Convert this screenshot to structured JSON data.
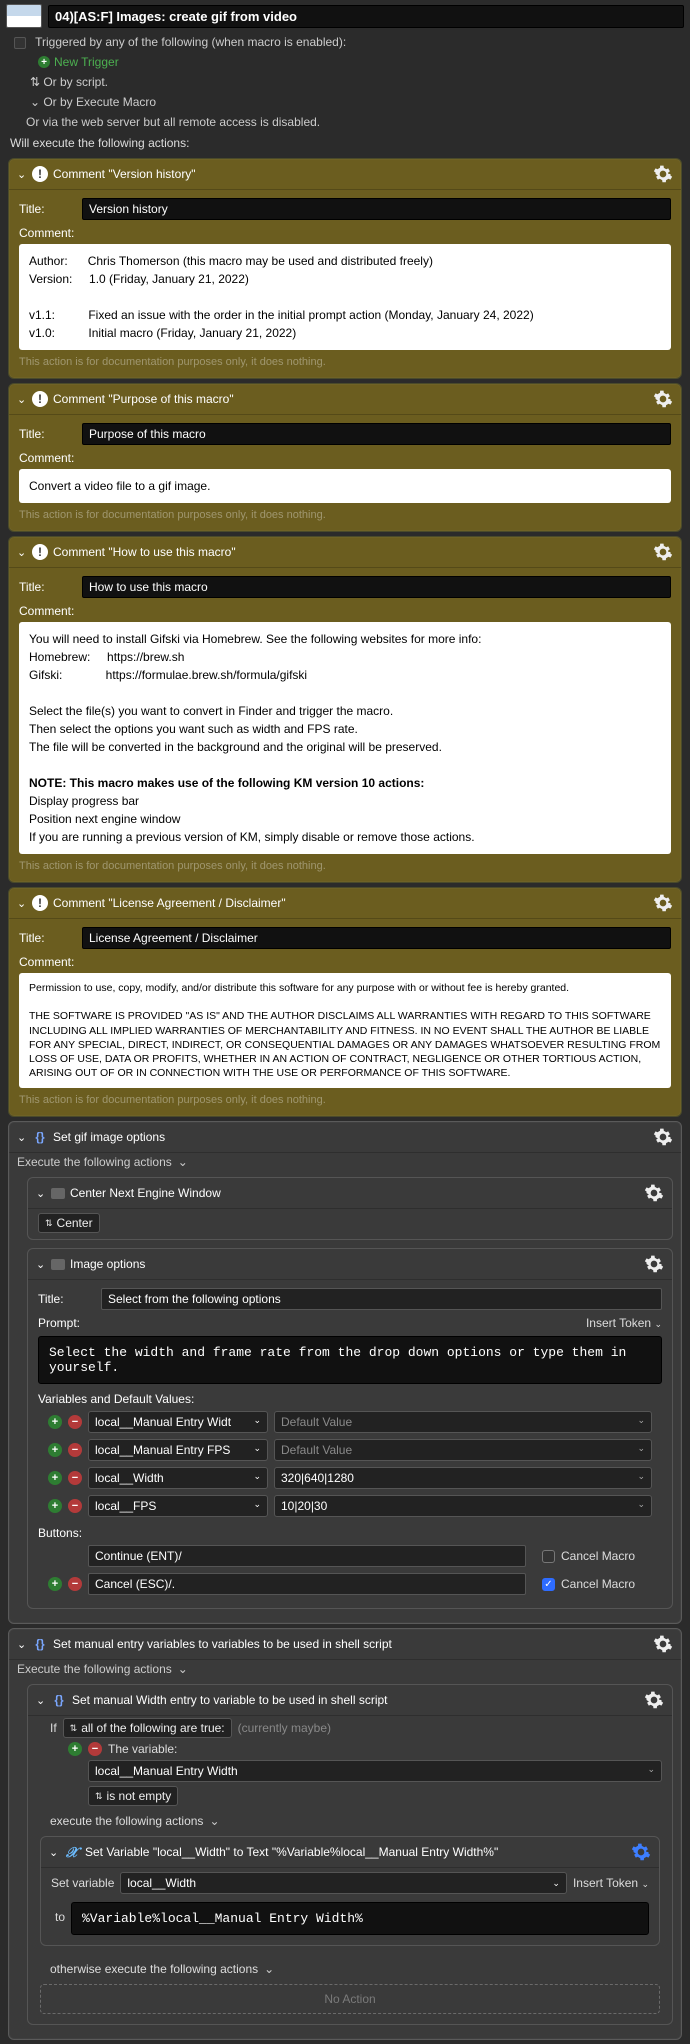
{
  "macro": {
    "title": "04)[AS:F] Images: create gif from video",
    "trigger_header": "Triggered by any of the following (when macro is enabled):",
    "new_trigger": "New Trigger",
    "or_script": "Or by script.",
    "or_execute": "Or by Execute Macro",
    "or_web": "Or via the web server but all remote access is disabled.",
    "will_execute": "Will execute the following actions:"
  },
  "comments": [
    {
      "head": "Comment \"Version history\"",
      "title_label": "Title:",
      "title_value": "Version history",
      "comment_label": "Comment:",
      "body_html": "Author:&nbsp;&nbsp;&nbsp;&nbsp;&nbsp;&nbsp;Chris Thomerson (this macro may be used and distributed freely)<br>Version:&nbsp;&nbsp;&nbsp;&nbsp;&nbsp;1.0 (Friday, January 21, 2022)<br><br>v1.1:&nbsp;&nbsp;&nbsp;&nbsp;&nbsp;&nbsp;&nbsp;&nbsp;&nbsp;&nbsp;Fixed an issue with the order in the initial prompt action (Monday, January 24, 2022)<br>v1.0:&nbsp;&nbsp;&nbsp;&nbsp;&nbsp;&nbsp;&nbsp;&nbsp;&nbsp;&nbsp;Initial macro (Friday, January 21, 2022)",
      "footer": "This action is for documentation purposes only, it does nothing."
    },
    {
      "head": "Comment \"Purpose of this macro\"",
      "title_value": "Purpose of this macro",
      "body_html": "Convert a video file to a gif image.",
      "footer": "This action is for documentation purposes only, it does nothing."
    },
    {
      "head": "Comment \"How to use this macro\"",
      "title_value": "How to use this macro",
      "body_html": "You will need to install Gifski via Homebrew. See the following websites for more info:<br>Homebrew:&nbsp;&nbsp;&nbsp;&nbsp;&nbsp;https://brew.sh<br>Gifski:&nbsp;&nbsp;&nbsp;&nbsp;&nbsp;&nbsp;&nbsp;&nbsp;&nbsp;&nbsp;&nbsp;&nbsp;&nbsp;https://formulae.brew.sh/formula/gifski<br><br>Select the file(s) you want to convert in Finder and trigger the macro.<br>Then select the options you want such as width and FPS rate.<br>The file will be converted in the background and the original will be preserved.<br><br><b>NOTE: This macro makes use of the following KM version 10 actions:</b><br>Display progress bar<br>Position next engine window<br>If you are running a previous version of KM, simply disable or remove those actions.",
      "footer": "This action is for documentation purposes only, it does nothing."
    },
    {
      "head": "Comment \"License Agreement / Disclaimer\"",
      "title_value": "License Agreement / Disclaimer",
      "body_html_small": "Permission to use, copy, modify, and/or distribute this software for any purpose with or without fee is hereby granted.<br><br>THE SOFTWARE IS PROVIDED \"AS IS\" AND THE AUTHOR DISCLAIMS ALL WARRANTIES WITH REGARD TO THIS SOFTWARE INCLUDING ALL IMPLIED WARRANTIES OF MERCHANTABILITY AND FITNESS. IN NO EVENT SHALL THE AUTHOR BE LIABLE FOR ANY SPECIAL, DIRECT, INDIRECT, OR CONSEQUENTIAL DAMAGES OR ANY DAMAGES WHATSOEVER RESULTING FROM LOSS OF USE, DATA OR PROFITS, WHETHER IN AN ACTION OF CONTRACT, NEGLIGENCE OR OTHER TORTIOUS ACTION, ARISING OUT OF OR IN CONNECTION WITH THE USE OR PERFORMANCE OF THIS SOFTWARE.",
      "footer": "This action is for documentation purposes only, it does nothing."
    }
  ],
  "labels": {
    "title": "Title:",
    "comment": "Comment:",
    "execute_following": "Execute the following actions",
    "center": "Center",
    "prompt": "Prompt:",
    "insert_token": "Insert Token",
    "vars_defaults": "Variables and Default Values:",
    "default_value": "Default Value",
    "buttons": "Buttons:",
    "cancel_macro": "Cancel Macro",
    "if": "If",
    "all_true": "all of the following are true:",
    "currently": "(currently maybe)",
    "the_variable": "The variable:",
    "is_not_empty": "is not empty",
    "execute_following2": "execute the following actions",
    "set_variable": "Set variable",
    "to": "to",
    "otherwise": "otherwise execute the following actions",
    "no_action": "No Action"
  },
  "group1": {
    "head": "Set gif image options",
    "child1_head": "Center Next Engine Window",
    "child2_head": "Image options",
    "child2_title": "Select from the following options",
    "prompt_text": "Select the width and frame rate from the drop down options or type them in yourself.",
    "vars": [
      {
        "name": "local__Manual Entry Widt",
        "value": "",
        "placeholder": true
      },
      {
        "name": "local__Manual Entry FPS",
        "value": "",
        "placeholder": true
      },
      {
        "name": "local__Width",
        "value": "320|640|1280",
        "placeholder": false
      },
      {
        "name": "local__FPS",
        "value": "10|20|30",
        "placeholder": false
      }
    ],
    "buttons": [
      {
        "label": "Continue (ENT)/",
        "cancel": false
      },
      {
        "label": "Cancel (ESC)/.",
        "cancel": true
      }
    ]
  },
  "group2": {
    "head": "Set manual entry variables to variables to be used in shell script",
    "child_head": "Set manual Width entry to variable to be used in shell script",
    "cond_var": "local__Manual Entry Width",
    "setvar_head": "Set Variable \"local__Width\" to Text \"%Variable%local__Manual Entry Width%\"",
    "setvar_var": "local__Width",
    "setvar_val": "%Variable%local__Manual Entry Width%"
  }
}
